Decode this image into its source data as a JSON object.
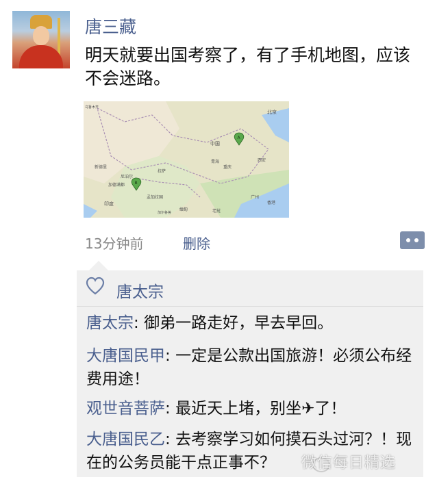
{
  "post": {
    "author": "唐三藏",
    "text": "明天就要出国考察了，有了手机地图，应该不会迷路。",
    "time": "13分钟前",
    "delete_label": "删除"
  },
  "map": {
    "labels": [
      "北京",
      "中国",
      "青海",
      "西安",
      "重庆",
      "拉萨",
      "尼泊尔",
      "新德里",
      "加德满都",
      "孟加拉国",
      "印度",
      "缅甸",
      "老挝",
      "香港",
      "广州",
      "加尔各答",
      "乌鲁木齐"
    ],
    "pins": [
      "A",
      "B"
    ]
  },
  "likes": {
    "names": "唐太宗"
  },
  "comments": [
    {
      "author": "唐太宗",
      "sep": ": ",
      "text": "御弟一路走好，早去早回。"
    },
    {
      "author": "大唐国民甲",
      "sep": ": ",
      "text": "一定是公款出国旅游！必须公布经费用途！"
    },
    {
      "author": "观世音菩萨",
      "sep": ": ",
      "text": "最近天上堵，别坐✈了！"
    },
    {
      "author": "大唐国民乙",
      "sep": ": ",
      "text": "去考察学习如何摸石头过河？！现在的公务员能干点正事不？"
    }
  ],
  "watermark": "微信每日精选",
  "colors": {
    "link": "#4a5f8e",
    "panel": "#f0f0f0",
    "meta": "#888888"
  }
}
